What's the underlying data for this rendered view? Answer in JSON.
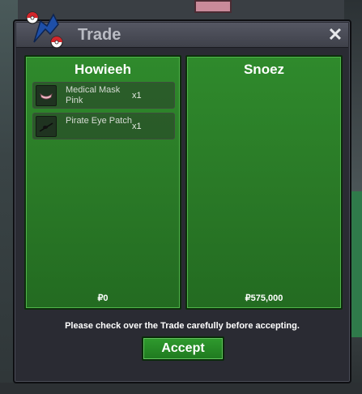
{
  "window": {
    "title": "Trade",
    "close_label": "✕"
  },
  "left_trader": {
    "name": "Howieeh",
    "money": "₽0",
    "items": [
      {
        "name": "Medical Mask Pink",
        "qty": "x1",
        "icon": "medical-mask-icon"
      },
      {
        "name": "Pirate Eye Patch",
        "qty": "x1",
        "icon": "eye-patch-icon"
      }
    ]
  },
  "right_trader": {
    "name": "Snoez",
    "money": "₽575,000",
    "items": []
  },
  "notice": "Please check over the Trade carefully before accepting.",
  "accept_label": "Accept",
  "colors": {
    "panel_green": "#2a7a27",
    "button_green": "#238a23",
    "window_bg": "#2a2b33"
  }
}
